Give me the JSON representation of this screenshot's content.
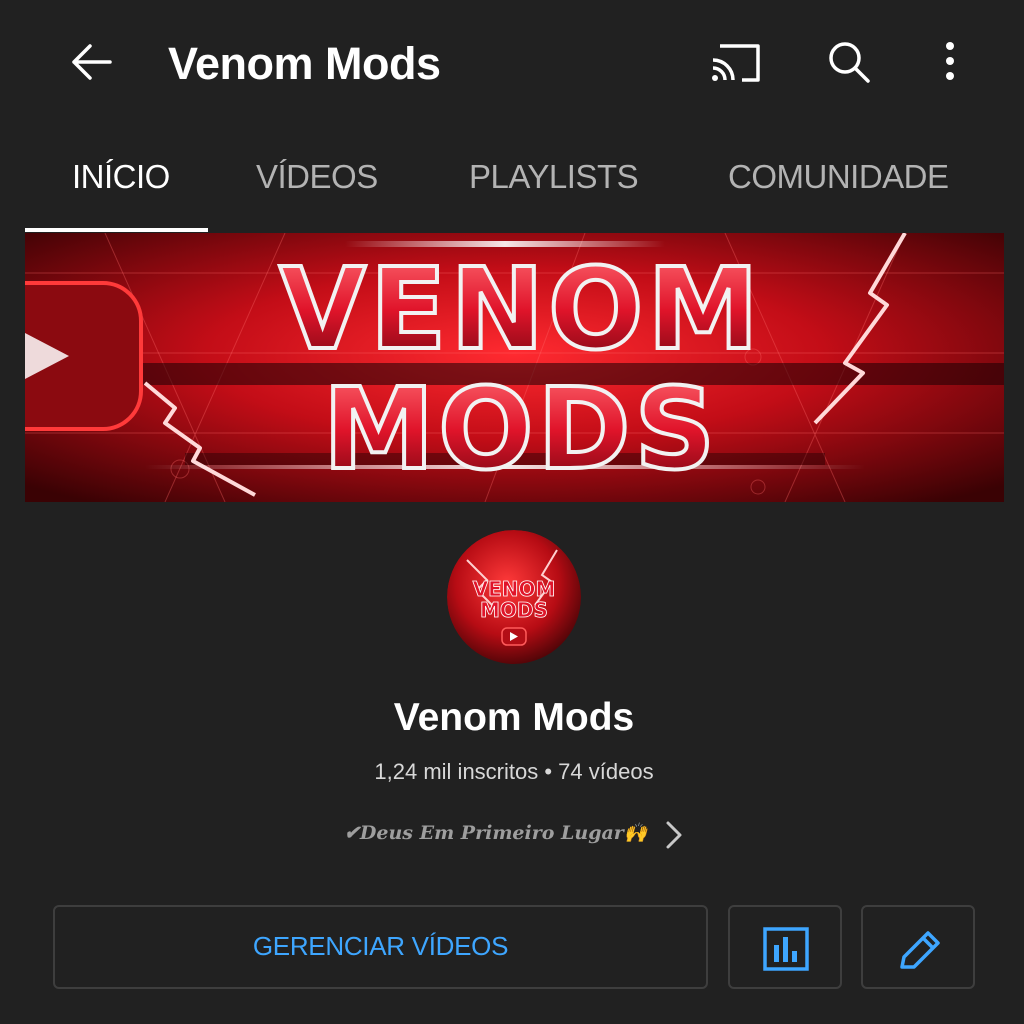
{
  "app_bar": {
    "title": "Venom Mods",
    "icons": [
      "arrow-left-icon",
      "cast-icon",
      "search-icon",
      "more-vert-icon"
    ]
  },
  "tabs": [
    {
      "label": "INÍCIO",
      "active": true
    },
    {
      "label": "VÍDEOS",
      "active": false
    },
    {
      "label": "PLAYLISTS",
      "active": false
    },
    {
      "label": "COMUNIDADE",
      "active": false
    }
  ],
  "banner": {
    "line1": "VENOM",
    "line2": "MODS"
  },
  "channel": {
    "name": "Venom Mods",
    "stats": "1,24 mil inscritos • 74 vídeos",
    "description": "✔Deus Em Primeiro Lugar🙌"
  },
  "avatar": {
    "line1": "VENOM",
    "line2": "MODS"
  },
  "actions": {
    "manage_videos": "GERENCIAR VÍDEOS",
    "stats_icon": "analytics-icon",
    "edit_icon": "pencil-icon"
  },
  "colors": {
    "background": "#212121",
    "accent_blue": "#3ea6ff",
    "banner_red": "#d4101e"
  }
}
